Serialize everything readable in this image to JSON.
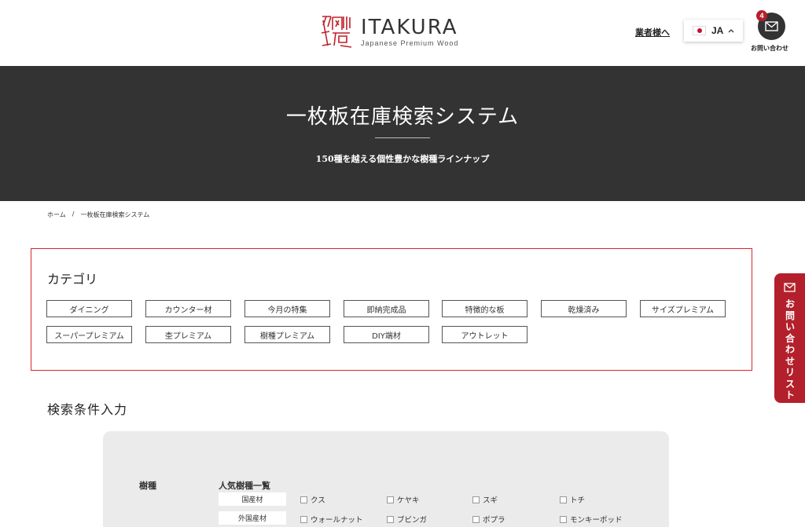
{
  "header": {
    "logo_name": "ITAKURA",
    "logo_sub": "Japanese Premium Wood",
    "business_link": "業者様へ",
    "language": "JA",
    "contact_badge": "4",
    "contact_label": "お問い合わせ"
  },
  "hero": {
    "title": "一枚板在庫検索システム",
    "subtitle": "150種を越える個性豊かな樹種ラインナップ"
  },
  "breadcrumb": {
    "home": "ホーム",
    "separator": "/",
    "current": "一枚板在庫検索システム"
  },
  "category": {
    "title": "カテゴリ",
    "items": [
      "ダイニング",
      "カウンター材",
      "今月の特集",
      "即納完成品",
      "特徴的な板",
      "乾燥済み",
      "サイズプレミアム",
      "スーパープレミアム",
      "杢プレミアム",
      "樹種プレミアム",
      "DIY端材",
      "アウトレット"
    ]
  },
  "search": {
    "title": "検索条件入力",
    "tree_label": "樹種",
    "popular_title": "人気樹種一覧",
    "groups": [
      {
        "label": "国産材",
        "options": [
          "クス",
          "ケヤキ",
          "スギ",
          "トチ"
        ]
      },
      {
        "label": "外国産材",
        "options": [
          "ウォールナット",
          "ブビンガ",
          "ポプラ",
          "モンキーポッド"
        ]
      }
    ]
  },
  "side_tab": {
    "label": "お問い合わせリスト"
  },
  "colors": {
    "accent_red": "#b3202b",
    "hero_bg": "#333333",
    "panel_bg": "#ebebeb"
  }
}
